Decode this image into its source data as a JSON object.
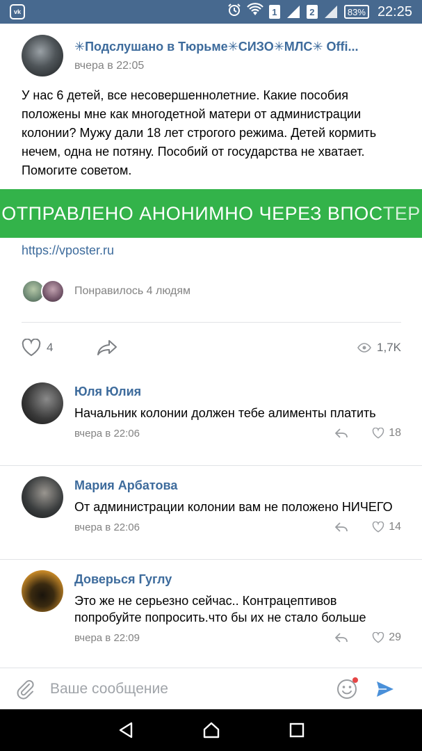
{
  "status_bar": {
    "sim1": "1",
    "sim2": "2",
    "battery": "83%",
    "time": "22:25",
    "icons": [
      "vk-notification-icon",
      "alarm-icon",
      "wifi-icon",
      "signal-icon",
      "battery-icon"
    ]
  },
  "post": {
    "group_name": "✳Подслушано в Тюрьме✳СИЗО✳МЛС✳ Offi...",
    "time": "вчера в 22:05",
    "text": "У нас 6 детей, все несовершеннолетние. Какие пособия положены мне как многодетной матери от администрации колонии? Мужу дали 18 лет строгого режима. Детей кормить нечем, одна не потяну. Пособий от государства не хватает. Помогите советом.",
    "banner_main": "ОТПРАВЛЕНО АНОНИМНО ЧЕРЕЗ ВПОС",
    "banner_fade": "ТЕР",
    "banner_color": "#33b34a",
    "link": "https://vposter.ru",
    "liked_by": "Понравилось 4 людям",
    "likes": "4",
    "views": "1,7K"
  },
  "comments": [
    {
      "author": "Юля Юлия",
      "text": "Начальник колонии должен тебе алименты платить",
      "time": "вчера в 22:06",
      "likes": "18"
    },
    {
      "author": "Мария Арбатова",
      "text": "От администрации колонии вам не положено НИЧЕГО",
      "time": "вчера в 22:06",
      "likes": "14"
    },
    {
      "author": "Доверься Гуглу",
      "text": "Это же не серьезно сейчас.. Контрацептивов попробуйте попросить.что бы их не стало больше",
      "time": "вчера в 22:09",
      "likes": "29"
    }
  ],
  "composer": {
    "placeholder": "Ваше сообщение"
  },
  "colors": {
    "status_bar": "#47698f",
    "link": "#3d6b9c",
    "send": "#4a90d9"
  }
}
